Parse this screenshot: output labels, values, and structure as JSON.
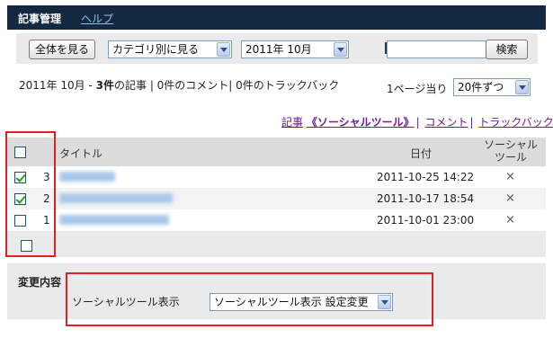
{
  "header": {
    "title": "記事管理",
    "help_link": "ヘルプ"
  },
  "toolbar": {
    "view_all_label": "全体を見る",
    "category_select": "カテゴリ別に見る",
    "month_select": "2011年 10月",
    "search_value": "",
    "search_label": "検索"
  },
  "summary": {
    "period": "2011年 10月 -",
    "article_count": "3件",
    "article_suffix": "の記事",
    "rest": "| 0件のコメント| 0件のトラックバック"
  },
  "per_page": {
    "label": "1ページ当り",
    "value": "20件ずつ"
  },
  "tabs": {
    "articles": "記事",
    "social": "《ソーシャルツール》",
    "comments": "コメント",
    "trackbacks": "トラックバック"
  },
  "table": {
    "header_title": "タイトル",
    "header_date": "日付",
    "header_social_line1": "ソーシャル",
    "header_social_line2": "ツール",
    "rows": [
      {
        "number": "3",
        "checked": true,
        "date": "2011-10-25 14:22",
        "social": "×"
      },
      {
        "number": "2",
        "checked": true,
        "date": "2011-10-17 18:54",
        "social": "×"
      },
      {
        "number": "1",
        "checked": false,
        "date": "2011-10-01 23:00",
        "social": "×"
      }
    ]
  },
  "change": {
    "label": "変更内容",
    "field_label": "ソーシャルツール表示",
    "select_value": "ソーシャルツール表示 設定変更"
  },
  "colors": {
    "header_bg": "#13293f",
    "highlight": "#e02020",
    "link": "#6a1b9a"
  }
}
